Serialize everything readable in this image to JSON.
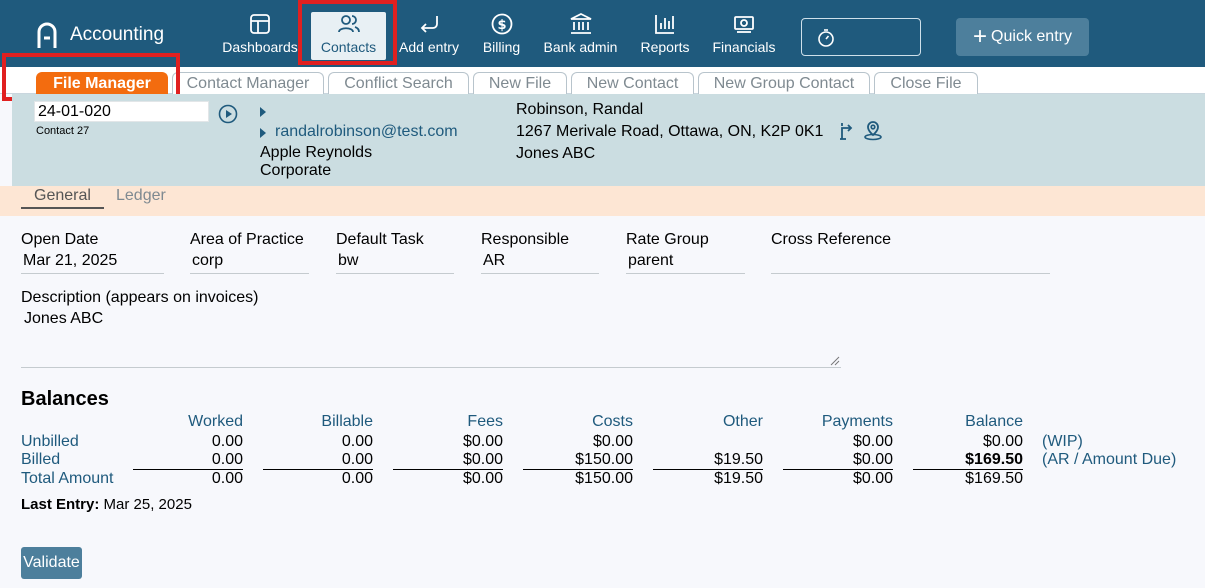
{
  "app": {
    "name": "Accounting"
  },
  "nav": {
    "items": [
      {
        "label": "Dashboards",
        "icon": "dashboard-icon"
      },
      {
        "label": "Contacts",
        "icon": "contacts-icon",
        "active": true
      },
      {
        "label": "Add entry",
        "icon": "return-arrow-icon"
      },
      {
        "label": "Billing",
        "icon": "dollar-circle-icon"
      },
      {
        "label": "Bank admin",
        "icon": "bank-icon"
      },
      {
        "label": "Reports",
        "icon": "bar-chart-icon"
      },
      {
        "label": "Financials",
        "icon": "money-icon"
      }
    ],
    "quick_entry_label": "Quick entry"
  },
  "tabs": [
    {
      "label": "File Manager",
      "active": true
    },
    {
      "label": "Contact Manager"
    },
    {
      "label": "Conflict Search"
    },
    {
      "label": "New File"
    },
    {
      "label": "New Contact"
    },
    {
      "label": "New Group Contact"
    },
    {
      "label": "Close File"
    }
  ],
  "file": {
    "number": "24-01-020",
    "contact_ref": "Contact 27",
    "email": "randalrobinson@test.com",
    "counsel": "Apple Reynolds",
    "type": "Corporate",
    "client_name": "Robinson, Randal",
    "address": "1267 Merivale Road, Ottawa, ON, K2P 0K1",
    "matter": "Jones ABC"
  },
  "subtabs": [
    {
      "label": "General",
      "active": true
    },
    {
      "label": "Ledger"
    }
  ],
  "fields": [
    {
      "label": "Open Date",
      "value": "Mar 21, 2025"
    },
    {
      "label": "Area of Practice",
      "value": "corp"
    },
    {
      "label": "Default Task",
      "value": "bw"
    },
    {
      "label": "Responsible",
      "value": "AR"
    },
    {
      "label": "Rate Group",
      "value": "parent"
    },
    {
      "label": "Cross Reference",
      "value": ""
    }
  ],
  "description": {
    "label": "Description (appears on invoices)",
    "value": "Jones ABC"
  },
  "balances": {
    "title": "Balances",
    "columns": [
      "Worked",
      "Billable",
      "Fees",
      "Costs",
      "Other",
      "Payments",
      "Balance"
    ],
    "rows": [
      {
        "label": "Unbilled",
        "values": [
          "0.00",
          "0.00",
          "$0.00",
          "$0.00",
          "",
          "$0.00",
          "$0.00"
        ],
        "note": "(WIP)"
      },
      {
        "label": "Billed",
        "values": [
          "0.00",
          "0.00",
          "$0.00",
          "$150.00",
          "$19.50",
          "$0.00",
          "$169.50"
        ],
        "note": "(AR / Amount Due)"
      },
      {
        "label": "Total Amount",
        "values": [
          "0.00",
          "0.00",
          "$0.00",
          "$150.00",
          "$19.50",
          "$0.00",
          "$169.50"
        ],
        "note": ""
      }
    ]
  },
  "last_entry": {
    "label": "Last Entry:",
    "value": "Mar 25, 2025"
  },
  "validate_label": "Validate",
  "colors": {
    "topbar": "#1f5a7d",
    "active_tab": "#f36c0f",
    "header_panel": "#cbdde1",
    "subtab_bar": "#fde6d4",
    "highlight": "#e02020"
  }
}
